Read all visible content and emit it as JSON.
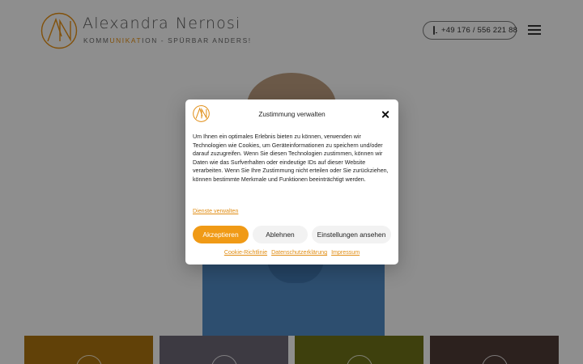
{
  "header": {
    "logo_name_first": "Alexandra",
    "logo_name_last": "Nernosi",
    "tagline_pre": "KOMM",
    "tagline_highlight": "UNIKAT",
    "tagline_post": "ION - SPÜRBAR ANDERS!",
    "phone": "+49 176 / 556 221 88",
    "phone_icon": "mobile-phone-icon",
    "menu_icon": "hamburger-menu-icon"
  },
  "tiles": [
    {
      "color": "#a8700e"
    },
    {
      "color": "#6a6472"
    },
    {
      "color": "#6b6e18"
    },
    {
      "color": "#4c3a35"
    }
  ],
  "consent": {
    "title": "Zustimmung verwalten",
    "close_icon": "close-icon",
    "body": "Um Ihnen ein optimales Erlebnis bieten zu können, verwenden wir Technologien wie Cookies, um Geräteinformationen zu speichern und/oder darauf zuzugreifen. Wenn Sie diesen Technologien zustimmen, können wir Daten wie das Surfverhalten oder eindeutige IDs auf dieser Website verarbeiten. Wenn Sie Ihre Zustimmung nicht erteilen oder Sie zurückziehen, können bestimmte Merkmale und Funktionen beeinträchtigt werden.",
    "manage_services": "Dienste verwalten",
    "accept": "Akzeptieren",
    "deny": "Ablehnen",
    "settings": "Einstellungen ansehen",
    "links": {
      "cookie": "Cookie-Richtlinie",
      "privacy": "Datenschutzerklärung",
      "imprint": "Impressum"
    },
    "accent_color": "#f09a16"
  }
}
